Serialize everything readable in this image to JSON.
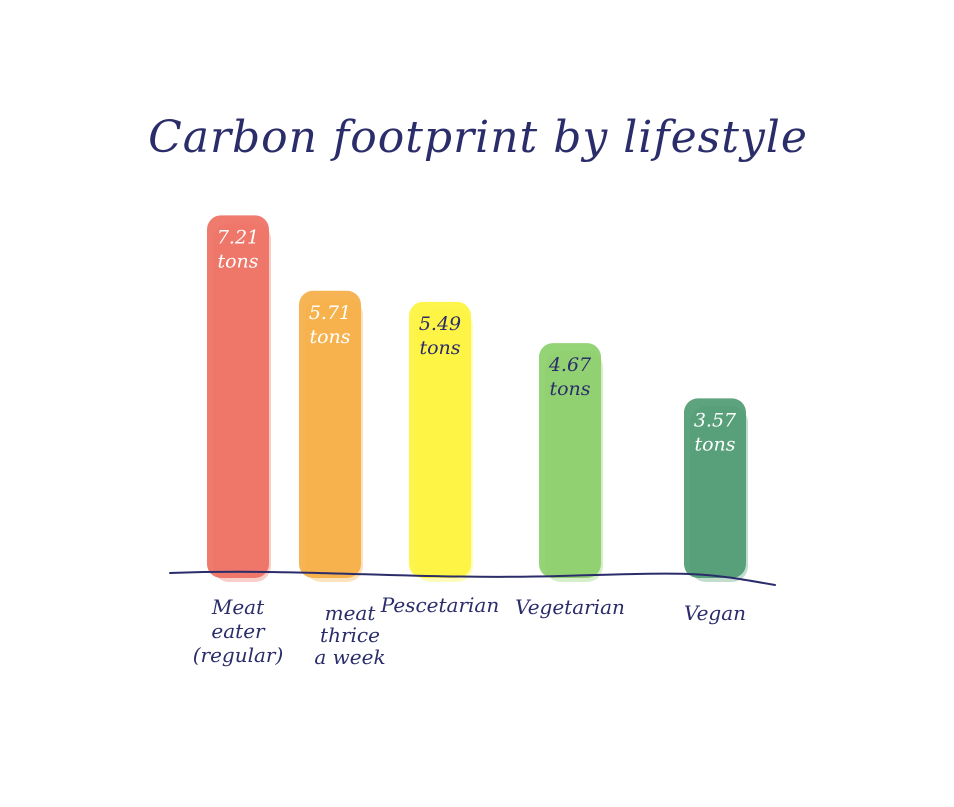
{
  "chart_data": {
    "type": "bar",
    "title": "Carbon footprint by lifestyle",
    "categories": [
      "Meat eater (regular)",
      "meat thrice a week",
      "Pescetarian",
      "Vegetarian",
      "Vegan"
    ],
    "values": [
      7.21,
      5.71,
      5.49,
      4.67,
      3.57
    ],
    "value_labels": [
      "7.21 tons",
      "5.71 tons",
      "5.49 tons",
      "4.67 tons",
      "3.57 tons"
    ],
    "unit": "tons",
    "xlabel": "",
    "ylabel": "",
    "grid": false,
    "legend": "none",
    "bar_colors": [
      "#ee7062",
      "#f6ae45",
      "#fdf43c",
      "#8ccf6b",
      "#4f9b72"
    ],
    "value_label_colors": [
      "#ffffff",
      "#ffffff",
      "#2b2d6b",
      "#2b2d6b",
      "#ffffff"
    ],
    "text_color": "#2b2d6b",
    "axis_color": "#2b2d6b"
  }
}
